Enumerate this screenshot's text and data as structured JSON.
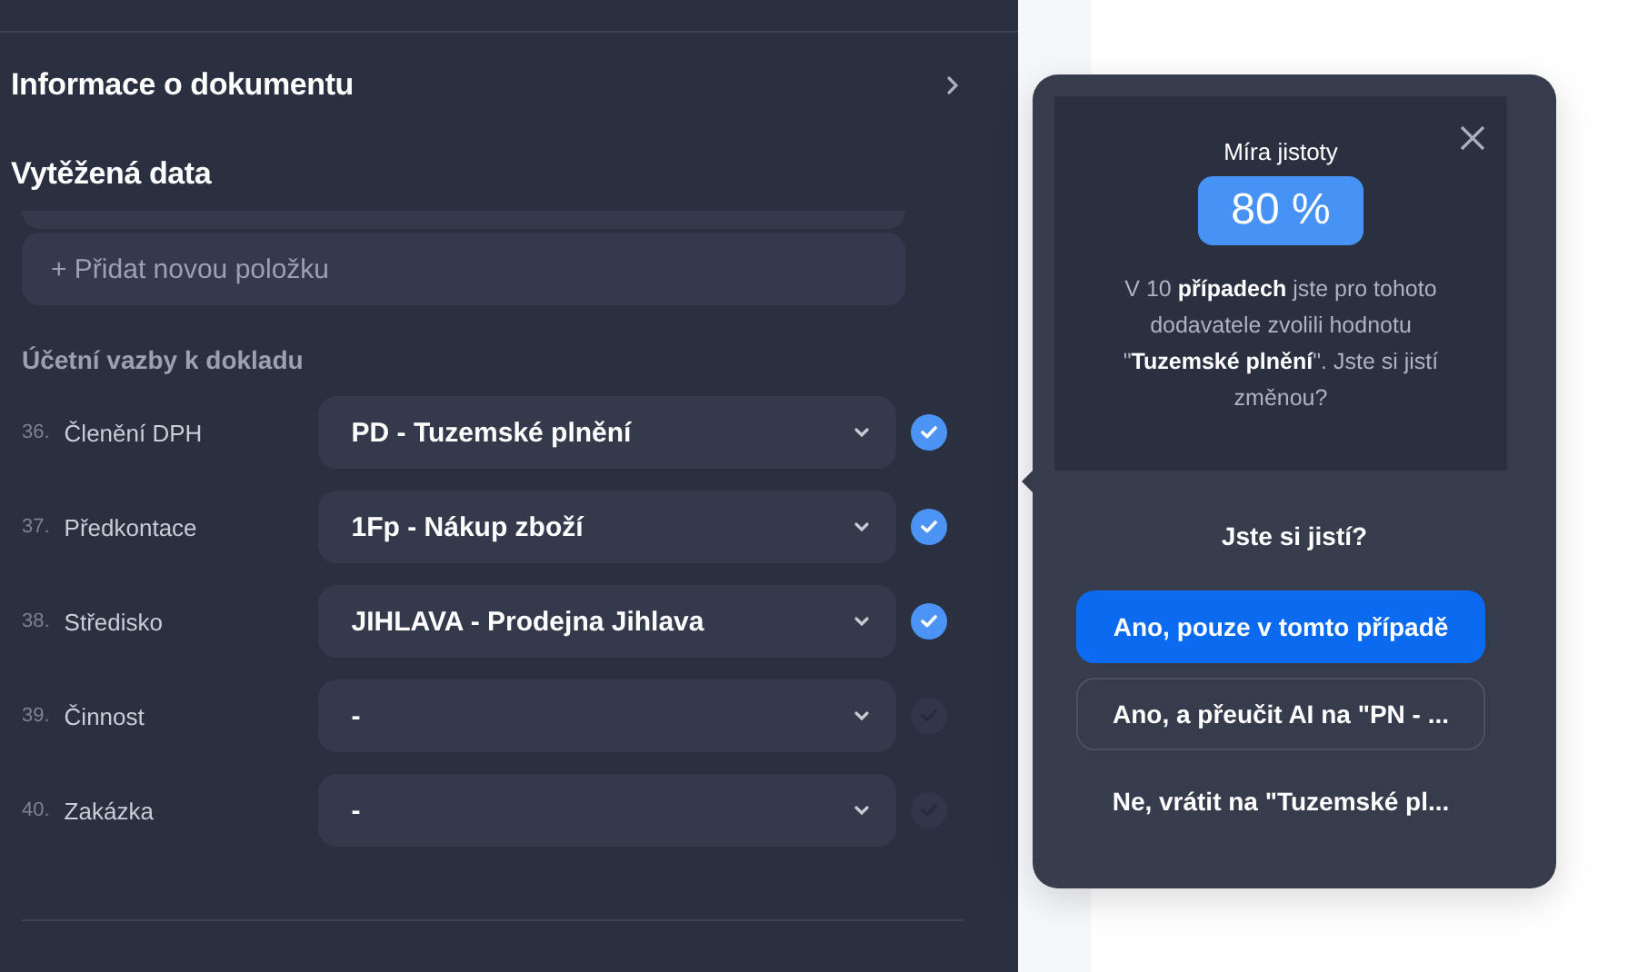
{
  "document_info": {
    "title": "Informace o dokumentu"
  },
  "extracted": {
    "title": "Vytěžená data",
    "add_item": "+ Přidat novou položku",
    "group_title": "Účetní vazby k dokladu",
    "fields": [
      {
        "number": "36.",
        "label": "Členění DPH",
        "value": "PD - Tuzemské plnění",
        "confirmed": true
      },
      {
        "number": "37.",
        "label": "Předkontace",
        "value": "1Fp - Nákup zboží",
        "confirmed": true
      },
      {
        "number": "38.",
        "label": "Středisko",
        "value": "JIHLAVA - Prodejna Jihlava",
        "confirmed": true
      },
      {
        "number": "39.",
        "label": "Činnost",
        "value": "-",
        "confirmed": false
      },
      {
        "number": "40.",
        "label": "Zakázka",
        "value": "-",
        "confirmed": false
      }
    ]
  },
  "popover": {
    "confidence_label": "Míra jistoty",
    "confidence": "80 %",
    "message": "V 10 **případech** jste pro tohoto dodavatele zvolili hodnotu \"**Tuzemské plnění**\". Jste si jistí změnou?",
    "question": "Jste si jistí?",
    "buttons": [
      {
        "label": "Ano, pouze v tomto případě",
        "kind": "primary"
      },
      {
        "label": "Ano, a přeučit AI na \"PN - ...",
        "kind": "outline"
      },
      {
        "label": "Ne, vrátit na \"Tuzemské pl...",
        "kind": "text"
      }
    ]
  }
}
